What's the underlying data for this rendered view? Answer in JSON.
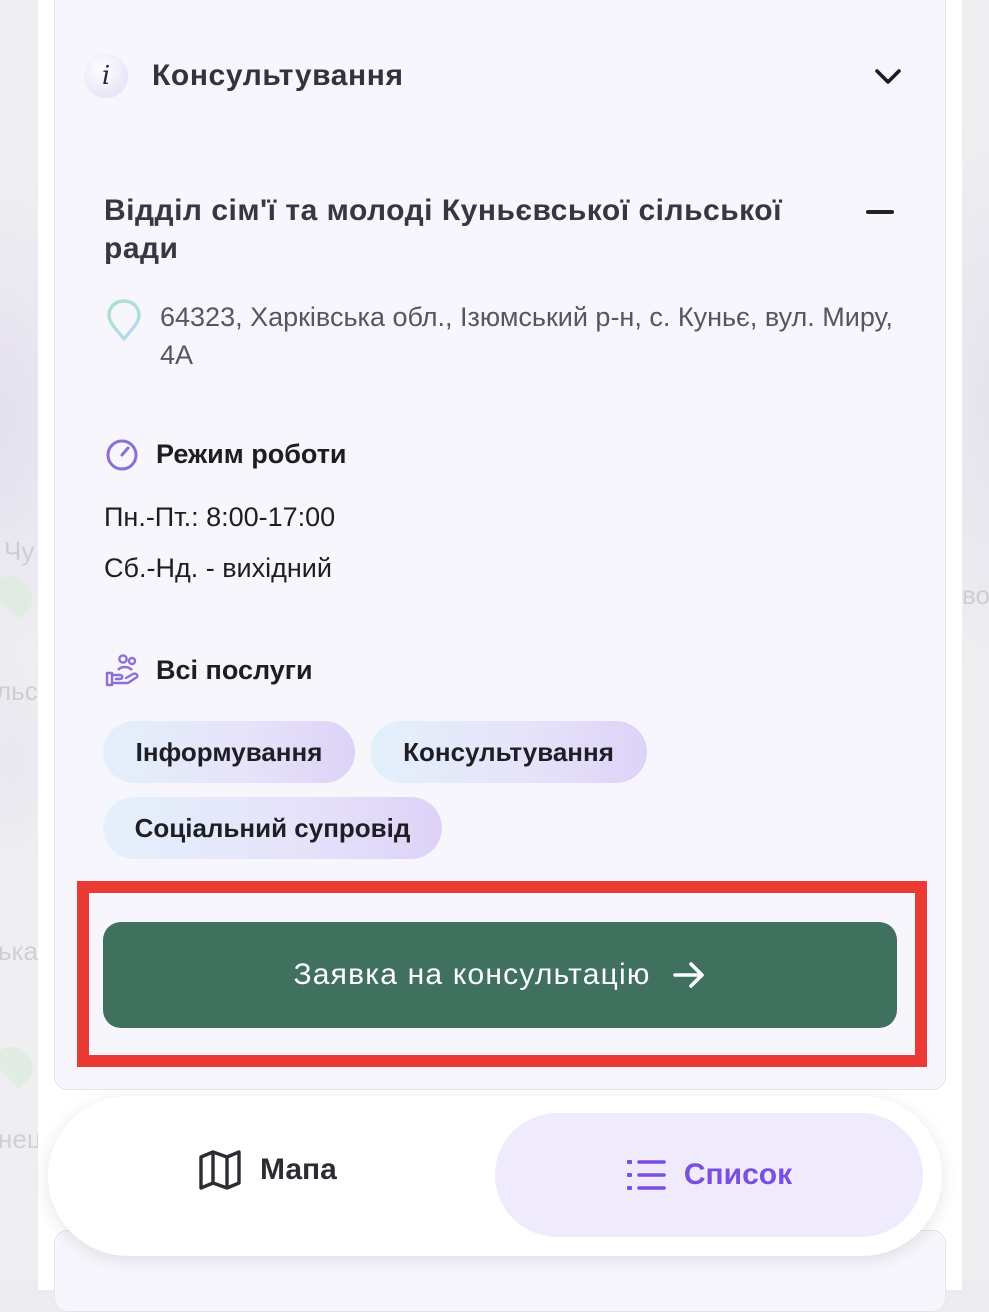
{
  "accordion": {
    "info_icon_glyph": "i",
    "title": "Консультування",
    "chevron_icon": "chevron-down-icon"
  },
  "organization": {
    "name": "Відділ сім'ї та молоді Куньєвської сільської ради",
    "address": "64323, Харківська обл., Ізюмський р-н, с. Куньє, вул. Миру, 4А"
  },
  "schedule": {
    "heading": "Режим роботи",
    "lines": [
      "Пн.-Пт.: 8:00-17:00",
      "Сб.-Нд. - вихідний"
    ]
  },
  "services": {
    "heading": "Всі послуги",
    "items": [
      "Інформування",
      "Консультування",
      "Соціальний супровід"
    ]
  },
  "cta": {
    "label": "Заявка на консультацію",
    "color": "#3f715e",
    "highlight_color": "#ea3a33"
  },
  "bottom_nav": {
    "map_label": "Мапа",
    "list_label": "Список",
    "active": "list",
    "active_color": "#7a4ee0"
  },
  "map_background": {
    "labels": [
      "Чу",
      "льсь",
      "ька",
      "нец",
      "во"
    ]
  }
}
